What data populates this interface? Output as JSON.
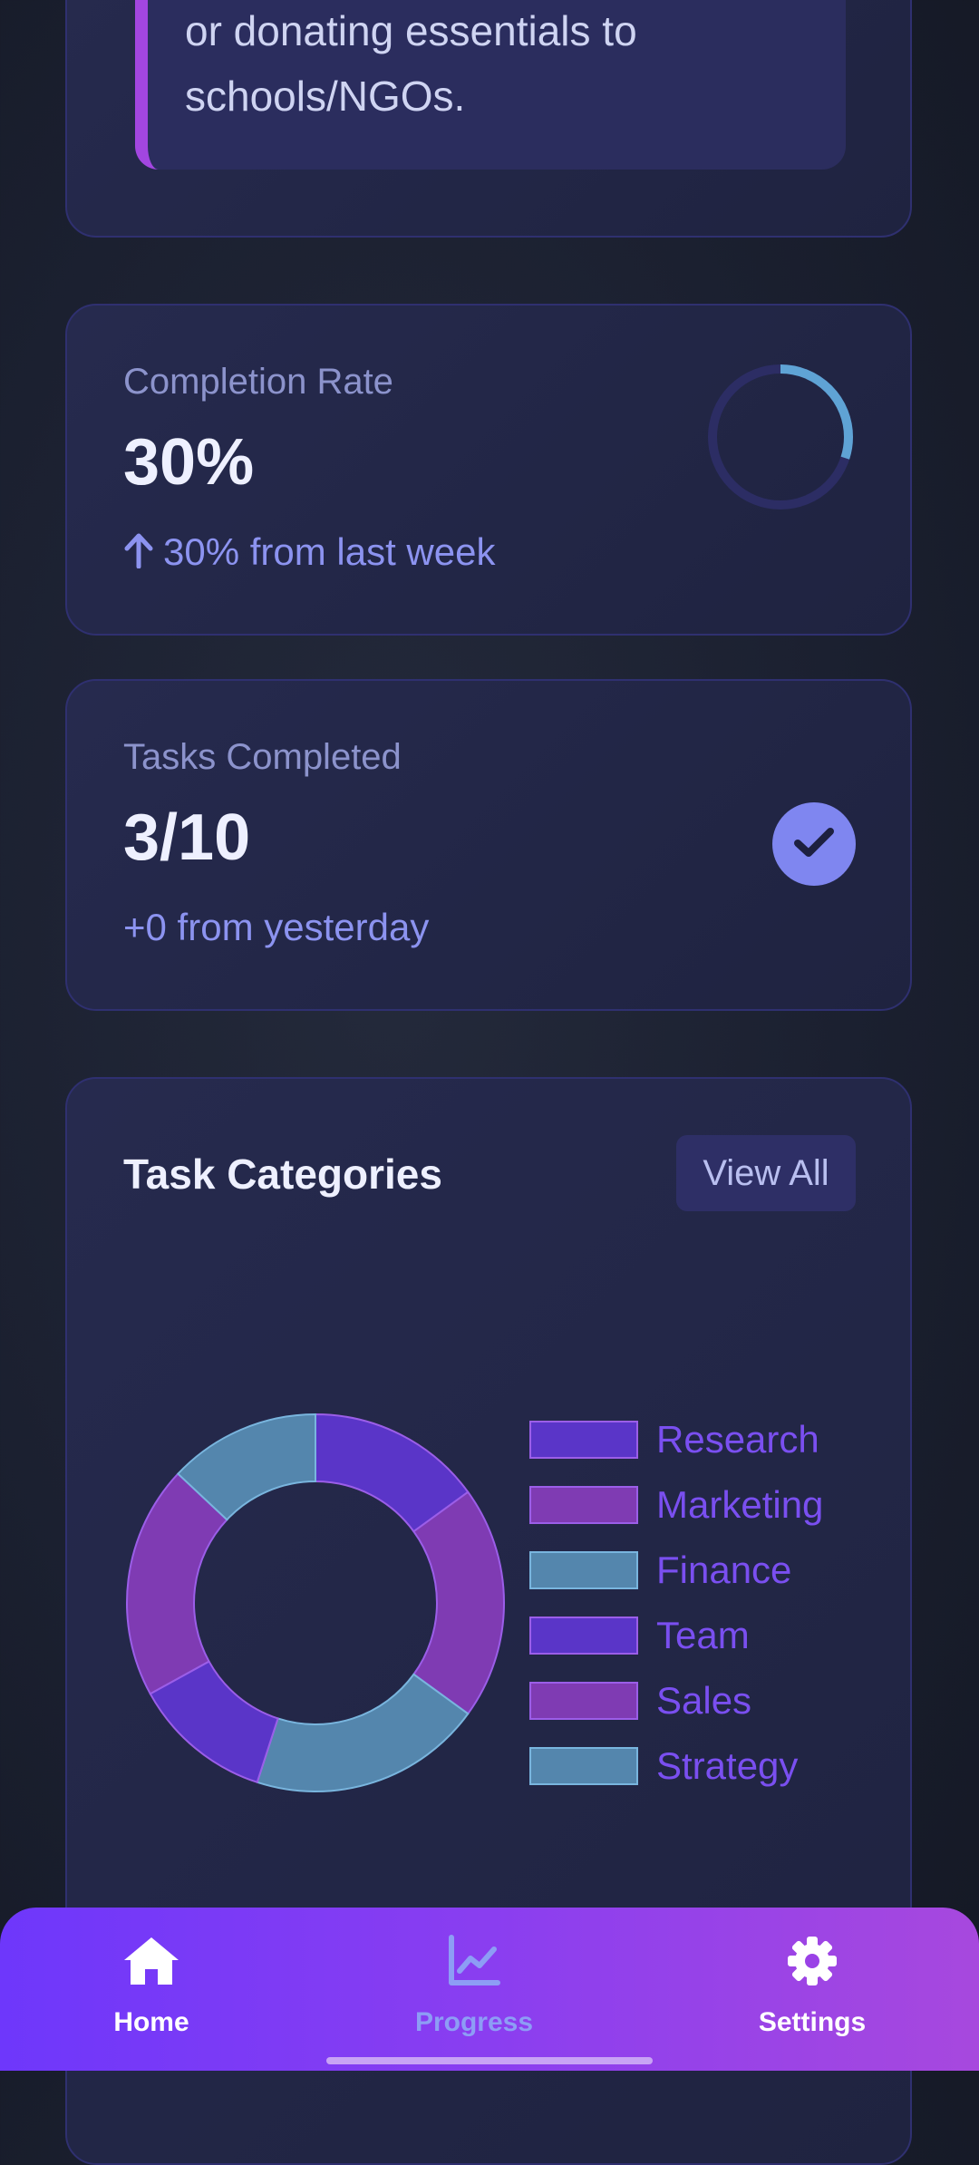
{
  "tip": {
    "lines": [
      "or donating essentials to",
      "schools/NGOs."
    ]
  },
  "completion": {
    "label": "Completion Rate",
    "value": "30%",
    "change": "30% from last week",
    "progress": 0.3,
    "arrow_icon": "arrow-up-icon"
  },
  "tasks": {
    "label": "Tasks Completed",
    "value": "3/10",
    "change": "+0 from yesterday",
    "badge_icon": "check-icon"
  },
  "categories": {
    "title": "Task Categories",
    "view_all_label": "View All"
  },
  "chart_data": {
    "type": "pie",
    "variant": "doughnut",
    "categories": [
      "Research",
      "Marketing",
      "Finance",
      "Team",
      "Sales",
      "Strategy"
    ],
    "values": [
      15,
      20,
      20,
      12,
      20,
      13
    ],
    "colors": [
      "#5a35c8",
      "#7f3bb3",
      "#5486ad",
      "#5a35c8",
      "#7f3bb3",
      "#5486ad"
    ],
    "legend_position": "right"
  },
  "nav": {
    "items": [
      {
        "label": "Home",
        "icon": "home-icon",
        "active": true
      },
      {
        "label": "Progress",
        "icon": "chart-line-icon",
        "active": false
      },
      {
        "label": "Settings",
        "icon": "gear-icon",
        "active": false
      }
    ]
  },
  "colors": {
    "accent_purple": "#6e37fb",
    "accent_magenta": "#a748de",
    "card_bg": "#23274a",
    "legend_text": "#7a4ff0"
  }
}
